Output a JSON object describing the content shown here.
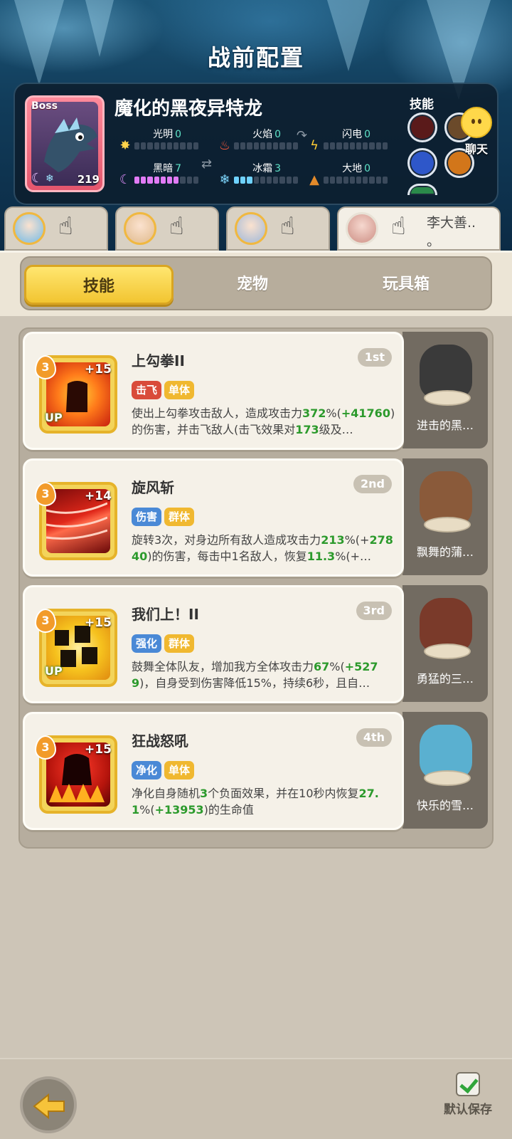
{
  "header": {
    "title": "战前配置"
  },
  "boss": {
    "tag": "Boss",
    "name": "魔化的黑夜异特龙",
    "level": "219",
    "elements": [
      {
        "name": "光明",
        "value": "0",
        "filled": 0
      },
      {
        "name": "火焰",
        "value": "0",
        "filled": 0
      },
      {
        "name": "闪电",
        "value": "0",
        "filled": 0
      },
      {
        "name": "黑暗",
        "value": "7",
        "filled": 7
      },
      {
        "name": "冰霜",
        "value": "3",
        "filled": 3
      },
      {
        "name": "大地",
        "value": "0",
        "filled": 0
      }
    ],
    "skills_label": "技能"
  },
  "chat": {
    "label": "聊天"
  },
  "team": {
    "slots": [
      {
        "avatar": "hero-girl-blue",
        "active": false
      },
      {
        "avatar": "hero-girl-goggles",
        "active": false
      },
      {
        "avatar": "hero-girl-silver",
        "active": false
      },
      {
        "avatar": "hero-boar",
        "name": "李大善..",
        "name_tail": "。",
        "active": true
      }
    ]
  },
  "tabs": [
    {
      "label": "技能",
      "selected": true
    },
    {
      "label": "宠物",
      "selected": false
    },
    {
      "label": "玩具箱",
      "selected": false
    }
  ],
  "skills": [
    {
      "name": "上勾拳II",
      "rank": "1st",
      "level": "3",
      "plus": "+15",
      "up": "UP",
      "tags": [
        {
          "text": "击飞",
          "color": "red"
        },
        {
          "text": "单体",
          "color": "yellow"
        }
      ],
      "desc": [
        {
          "t": "使出上勾拳攻击敌人，造成攻击力"
        },
        {
          "t": "372",
          "g": true
        },
        {
          "t": "%("
        },
        {
          "t": "+41760",
          "g": true
        },
        {
          "t": ")的伤害，并击飞敌人(击飞效果对"
        },
        {
          "t": "173",
          "g": true
        },
        {
          "t": "级及…"
        }
      ],
      "pet": "进击的黑…",
      "pet_color": "#3a3a3a",
      "icon_color": "#e9541b"
    },
    {
      "name": "旋风斩",
      "rank": "2nd",
      "level": "3",
      "plus": "+14",
      "up": "",
      "tags": [
        {
          "text": "伤害",
          "color": "blue"
        },
        {
          "text": "群体",
          "color": "yellow"
        }
      ],
      "desc": [
        {
          "t": "旋转3次，对身边所有敌人造成攻击力"
        },
        {
          "t": "213",
          "g": true
        },
        {
          "t": "%(+"
        },
        {
          "t": "27840",
          "g": true
        },
        {
          "t": ")的伤害，每击中1名敌人，恢复"
        },
        {
          "t": "11.3",
          "g": true
        },
        {
          "t": "%(+…"
        }
      ],
      "pet": "飘舞的蒲…",
      "pet_color": "#8a5a3a",
      "icon_color": "#c41e1e"
    },
    {
      "name": "我们上！II",
      "rank": "3rd",
      "level": "3",
      "plus": "+15",
      "up": "UP",
      "tags": [
        {
          "text": "强化",
          "color": "blue"
        },
        {
          "text": "群体",
          "color": "yellow"
        }
      ],
      "desc": [
        {
          "t": "鼓舞全体队友，增加我方全体攻击力"
        },
        {
          "t": "67",
          "g": true
        },
        {
          "t": "%("
        },
        {
          "t": "+5279",
          "g": true
        },
        {
          "t": ")，自身受到伤害降低15%，持续6秒，且自…"
        }
      ],
      "pet": "勇猛的三…",
      "pet_color": "#7a3a2a",
      "icon_color": "#f2b91e"
    },
    {
      "name": "狂战怒吼",
      "rank": "4th",
      "level": "3",
      "plus": "+15",
      "up": "",
      "tags": [
        {
          "text": "净化",
          "color": "blue"
        },
        {
          "text": "单体",
          "color": "yellow"
        }
      ],
      "desc": [
        {
          "t": "净化自身随机"
        },
        {
          "t": "3",
          "g": true
        },
        {
          "t": "个负面效果，并在10秒内恢复"
        },
        {
          "t": "27.1",
          "g": true
        },
        {
          "t": "%("
        },
        {
          "t": "+13953",
          "g": true
        },
        {
          "t": ")的生命值"
        }
      ],
      "pet": "快乐的雪…",
      "pet_color": "#5ab0d0",
      "icon_color": "#d8321a"
    }
  ],
  "footer": {
    "save_label": "默认保存"
  }
}
